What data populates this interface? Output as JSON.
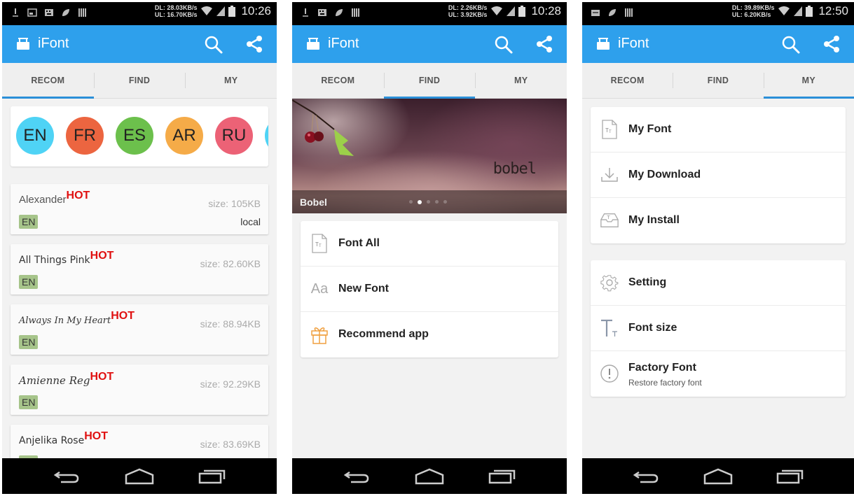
{
  "screens": [
    {
      "status": {
        "dl": "DL: 28.03KB/s",
        "ul": "UL: 16.70KB/s",
        "time": "10:26"
      },
      "app_title": "iFont",
      "tabs": [
        {
          "label": "RECOM",
          "active": true
        },
        {
          "label": "FIND",
          "active": false
        },
        {
          "label": "MY",
          "active": false
        }
      ],
      "languages": [
        {
          "code": "EN",
          "color": "#4fd3f5"
        },
        {
          "code": "FR",
          "color": "#ec6540"
        },
        {
          "code": "ES",
          "color": "#6cc04c"
        },
        {
          "code": "AR",
          "color": "#f5ab48"
        },
        {
          "code": "RU",
          "color": "#ec6276"
        },
        {
          "code": "",
          "color": "#4fd3f5"
        }
      ],
      "fonts": [
        {
          "name": "Alexander",
          "badge": "HOT",
          "size": "size: 105KB",
          "lang": "EN",
          "status": "local"
        },
        {
          "name": "All Things Pink",
          "badge": "HOT",
          "size": "size: 82.60KB",
          "lang": "EN",
          "status": ""
        },
        {
          "name": "Always In My Heart",
          "badge": "HOT",
          "size": "size: 88.94KB",
          "lang": "EN",
          "status": ""
        },
        {
          "name": "Amienne Reg",
          "badge": "HOT",
          "size": "size: 92.29KB",
          "lang": "EN",
          "status": ""
        },
        {
          "name": "Anjelika Rose",
          "badge": "HOT",
          "size": "size: 83.69KB",
          "lang": "EN",
          "status": ""
        }
      ]
    },
    {
      "status": {
        "dl": "DL: 2.26KB/s",
        "ul": "UL: 3.92KB/s",
        "time": "10:28"
      },
      "app_title": "iFont",
      "tabs": [
        {
          "label": "RECOM",
          "active": false
        },
        {
          "label": "FIND",
          "active": true
        },
        {
          "label": "MY",
          "active": false
        }
      ],
      "banner": {
        "caption": "Bobel",
        "watermark": "bobel",
        "slide_count": 5,
        "active_slide": 2
      },
      "menu": [
        {
          "icon": "font-file-icon",
          "label": "Font All"
        },
        {
          "icon": "aa-icon",
          "label": "New Font",
          "glyph": "Aa"
        },
        {
          "icon": "gift-icon",
          "label": "Recommend app"
        }
      ]
    },
    {
      "status": {
        "dl": "DL: 39.89KB/s",
        "ul": "UL: 6.20KB/s",
        "time": "12:50"
      },
      "app_title": "iFont",
      "tabs": [
        {
          "label": "RECOM",
          "active": false
        },
        {
          "label": "FIND",
          "active": false
        },
        {
          "label": "MY",
          "active": true
        }
      ],
      "menu_group_1": [
        {
          "icon": "font-file-icon",
          "label": "My Font"
        },
        {
          "icon": "download-icon",
          "label": "My Download"
        },
        {
          "icon": "install-tray-icon",
          "label": "My Install"
        }
      ],
      "menu_group_2": [
        {
          "icon": "gear-icon",
          "label": "Setting"
        },
        {
          "icon": "font-size-icon",
          "label": "Font size"
        },
        {
          "icon": "alert-circle-icon",
          "label": "Factory Font",
          "sub": "Restore factory font"
        }
      ]
    }
  ],
  "colors": {
    "accent": "#2ea0ec",
    "tab_indicator": "#2b8fd8",
    "hot": "#e01010",
    "lang_tag": "#a6c48a"
  }
}
